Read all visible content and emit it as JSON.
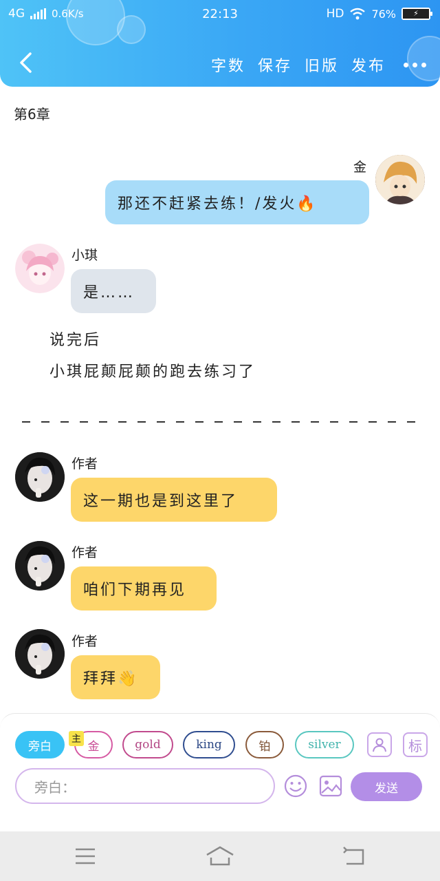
{
  "status": {
    "network": "4G",
    "speed": "0.6K/s",
    "time": "22:13",
    "hd": "HD",
    "battery": "76%"
  },
  "nav": {
    "word_count": "字数",
    "save": "保存",
    "old_version": "旧版",
    "publish": "发布"
  },
  "chapter_title": "第6章",
  "messages": [
    {
      "name": "金",
      "text": "那还不赶紧去练！/发火🔥"
    },
    {
      "name": "小琪",
      "text": "是……"
    }
  ],
  "narration": [
    "说完后",
    "小琪屁颠屁颠的跑去练习了"
  ],
  "author_messages": [
    {
      "name": "作者",
      "text": "这一期也是到这里了"
    },
    {
      "name": "作者",
      "text": "咱们下期再见"
    },
    {
      "name": "作者",
      "text": "拜拜👋"
    }
  ],
  "composer": {
    "chips": [
      "旁白",
      "金",
      "gold",
      "king",
      "铂",
      "silver"
    ],
    "main_tag": "主",
    "tag_button": "标",
    "input_placeholder": "旁白：",
    "send": "发送"
  },
  "colors": {
    "header": "#3aa7f5",
    "bubble_blue": "#a8dcf9",
    "bubble_grey": "#dfe5ec",
    "bubble_yellow": "#fdd66a",
    "send": "#b38ee7"
  }
}
